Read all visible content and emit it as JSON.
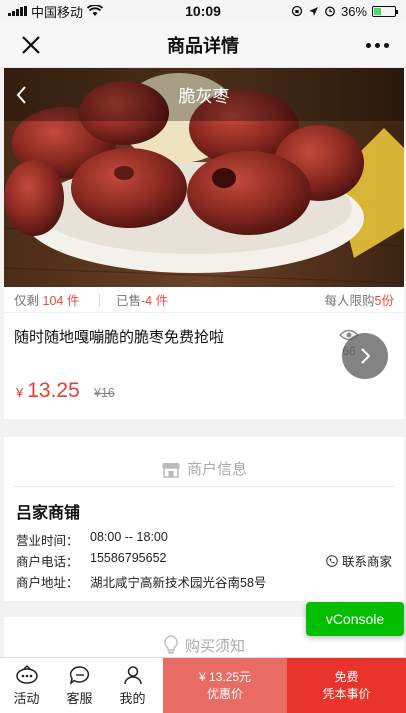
{
  "status_bar": {
    "carrier": "中国移动",
    "time": "10:09",
    "battery": "36%",
    "battery_level": 0.36
  },
  "navbar": {
    "title": "商品详情"
  },
  "hero": {
    "title": "脆灰枣"
  },
  "stock": {
    "remaining_prefix": "仅剩",
    "remaining_value": "104",
    "remaining_unit": "件",
    "sold_prefix": "已售",
    "sold_value": "-4",
    "sold_unit": "件",
    "limit_prefix": "每人限购",
    "limit_value": "5",
    "limit_unit": "份"
  },
  "product": {
    "name": "随时随地嘎嘣脆的脆枣免费抢啦",
    "views": "66",
    "price_symbol": "¥",
    "price": "13.25",
    "original_price": "¥16"
  },
  "merchant": {
    "section_title": "商户信息",
    "shop_name": "吕家商铺",
    "hours_label": "营业时间：",
    "hours_value": "08:00 -- 18:00",
    "phone_label": "商户电话：",
    "phone_value": "15586795652",
    "address_label": "商户地址：",
    "address_value": "湖北咸宁高新技术园光谷南58号",
    "contact_label": "联系商家"
  },
  "notes": {
    "section_title": "购买须知"
  },
  "vconsole": {
    "label": "vConsole"
  },
  "bottom_bar": {
    "tabs": [
      {
        "label": "活动",
        "icon": "activity-icon"
      },
      {
        "label": "客服",
        "icon": "chat-icon"
      },
      {
        "label": "我的",
        "icon": "user-icon"
      }
    ],
    "buy_price": "¥ 13.25元",
    "buy_label": "优惠价",
    "free_line1": "免费",
    "free_line2": "凭本事价"
  }
}
